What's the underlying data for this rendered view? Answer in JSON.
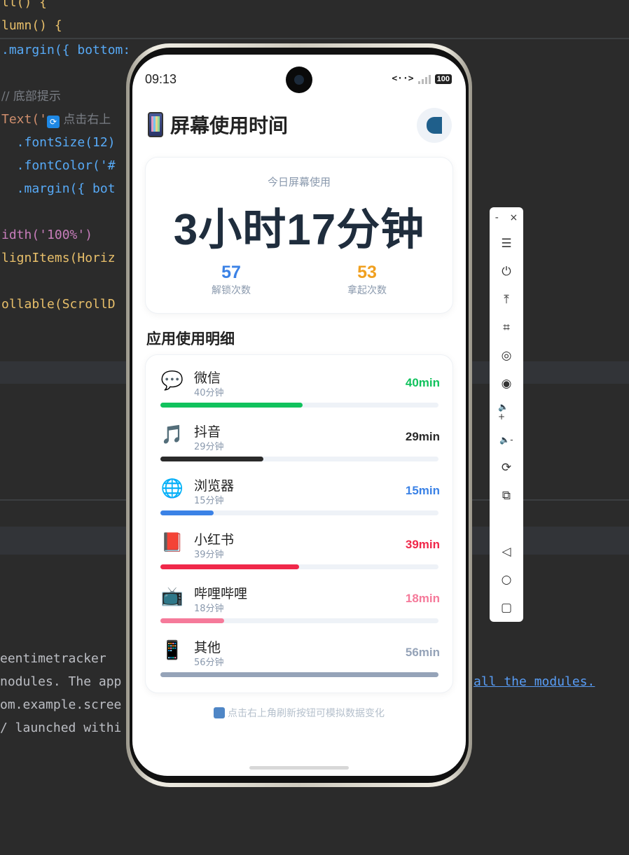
{
  "ide": {
    "code_lines": [
      "ll() {",
      "lumn() {",
      ".margin({ bottom:",
      "// 底部提示",
      "Text('",
      " 点击右上",
      "  .fontSize(12)",
      "  .fontColor('#",
      "  .margin({ bot",
      "idth('100%')",
      "lignItems(Horiz",
      "ollable(ScrollD"
    ],
    "log_lines": [
      "eentimetracker",
      "nodules. The app",
      "om.example.scree",
      "/ launched withi"
    ],
    "log_link": "all the modules."
  },
  "status_bar": {
    "time": "09:13",
    "network": "<··>",
    "battery": "100"
  },
  "header": {
    "title": "屏幕使用时间",
    "icon": "phone-icon",
    "refresh_icon": "refresh-icon"
  },
  "summary": {
    "label": "今日屏幕使用",
    "value": "3小时17分钟",
    "unlocks": {
      "value": "57",
      "label": "解锁次数",
      "color": "#3b82e6"
    },
    "pickups": {
      "value": "53",
      "label": "拿起次数",
      "color": "#f0a020"
    }
  },
  "section_title": "应用使用明细",
  "apps": [
    {
      "name": "微信",
      "sub": "40分钟",
      "min": "40min",
      "minutes": 40,
      "color": "#11c25d",
      "icon": "💬"
    },
    {
      "name": "抖音",
      "sub": "29分钟",
      "min": "29min",
      "minutes": 29,
      "color": "#2a2a2a",
      "icon": "🎵"
    },
    {
      "name": "浏览器",
      "sub": "15分钟",
      "min": "15min",
      "minutes": 15,
      "color": "#3b82e6",
      "icon": "🌐"
    },
    {
      "name": "小红书",
      "sub": "39分钟",
      "min": "39min",
      "minutes": 39,
      "color": "#f0284a",
      "icon": "📕"
    },
    {
      "name": "哔哩哔哩",
      "sub": "18分钟",
      "min": "18min",
      "minutes": 18,
      "color": "#f57a9a",
      "icon": "📺"
    },
    {
      "name": "其他",
      "sub": "56分钟",
      "min": "56min",
      "minutes": 56,
      "color": "#95a3b8",
      "icon": "📱"
    }
  ],
  "footer_tip": "点击右上角刷新按钮可模拟数据变化",
  "toolbar": {
    "minimize": "-",
    "close": "×",
    "buttons": [
      "☰",
      "⏻",
      "⤒",
      "⌗",
      "◎",
      "◉",
      "🔈+",
      "🔈-",
      "⟳",
      "⧉",
      "◁",
      "○",
      "▢"
    ]
  }
}
